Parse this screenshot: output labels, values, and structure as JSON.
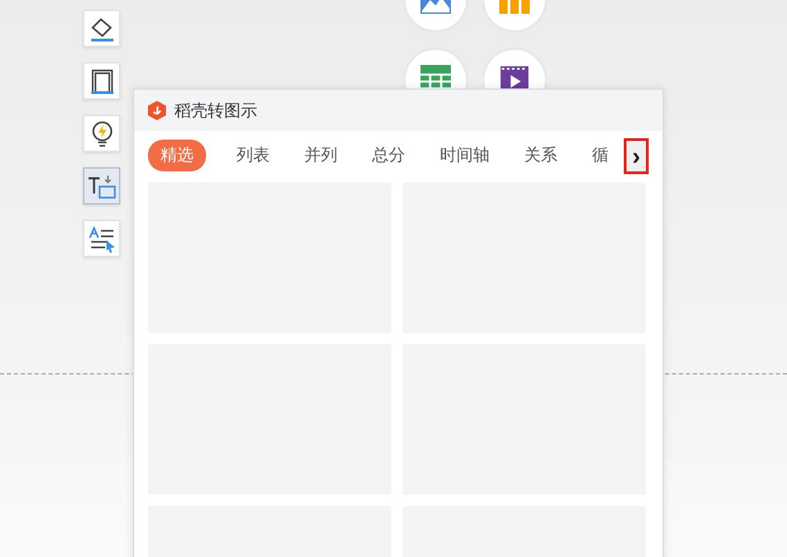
{
  "toolbar": [
    {
      "kind": "fill",
      "selected": false
    },
    {
      "kind": "frame",
      "selected": false
    },
    {
      "kind": "bulb",
      "selected": false
    },
    {
      "kind": "convert",
      "selected": true
    },
    {
      "kind": "text-style",
      "selected": false
    }
  ],
  "insert_buttons": [
    {
      "kind": "image"
    },
    {
      "kind": "chart"
    },
    {
      "kind": "table"
    },
    {
      "kind": "video"
    }
  ],
  "panel": {
    "title": "稻壳转图示",
    "tabs": [
      {
        "label": "精选",
        "selected": true
      },
      {
        "label": "列表",
        "selected": false
      },
      {
        "label": "并列",
        "selected": false
      },
      {
        "label": "总分",
        "selected": false
      },
      {
        "label": "时间轴",
        "selected": false
      },
      {
        "label": "关系",
        "selected": false
      },
      {
        "label": "循",
        "selected": false
      }
    ],
    "next_arrow": {
      "label": "›",
      "highlighted": true
    },
    "cards": [
      {
        "kind": "placeholder"
      },
      {
        "kind": "placeholder"
      },
      {
        "kind": "placeholder"
      },
      {
        "kind": "placeholder"
      },
      {
        "kind": "placeholder"
      },
      {
        "kind": "placeholder"
      }
    ]
  }
}
